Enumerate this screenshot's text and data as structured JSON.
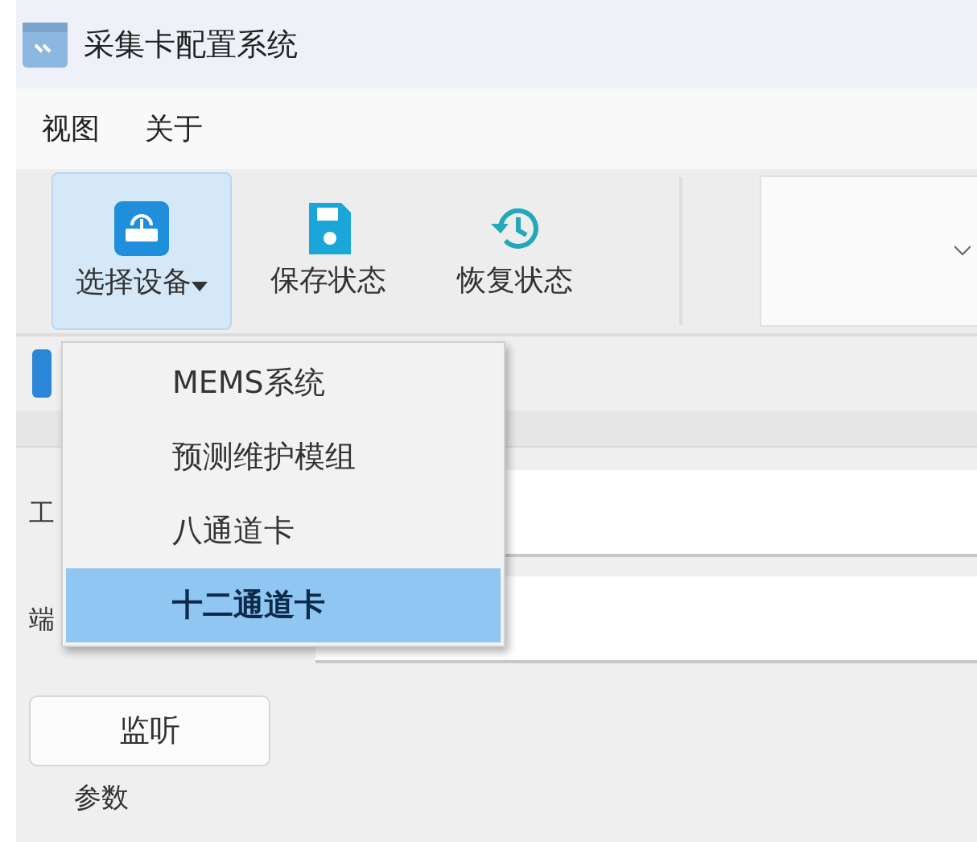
{
  "window": {
    "title": "采集卡配置系统"
  },
  "menu_bar": [
    "视图",
    "关于"
  ],
  "toolbar": [
    {
      "label": "选择设备",
      "dropdown": true,
      "active": true
    },
    {
      "label": "保存状态",
      "dropdown": false,
      "active": false
    },
    {
      "label": "恢复状态",
      "dropdown": false,
      "active": false
    }
  ],
  "device_menu": [
    {
      "label": "MEMS系统",
      "selected": false
    },
    {
      "label": "预测维护模组",
      "selected": false
    },
    {
      "label": "八通道卡",
      "selected": false
    },
    {
      "label": "十二通道卡",
      "selected": true
    }
  ],
  "fields": [
    {
      "label": "工"
    },
    {
      "label": "端"
    }
  ],
  "buttons": [
    "监听"
  ],
  "group": {
    "title": "参数"
  }
}
